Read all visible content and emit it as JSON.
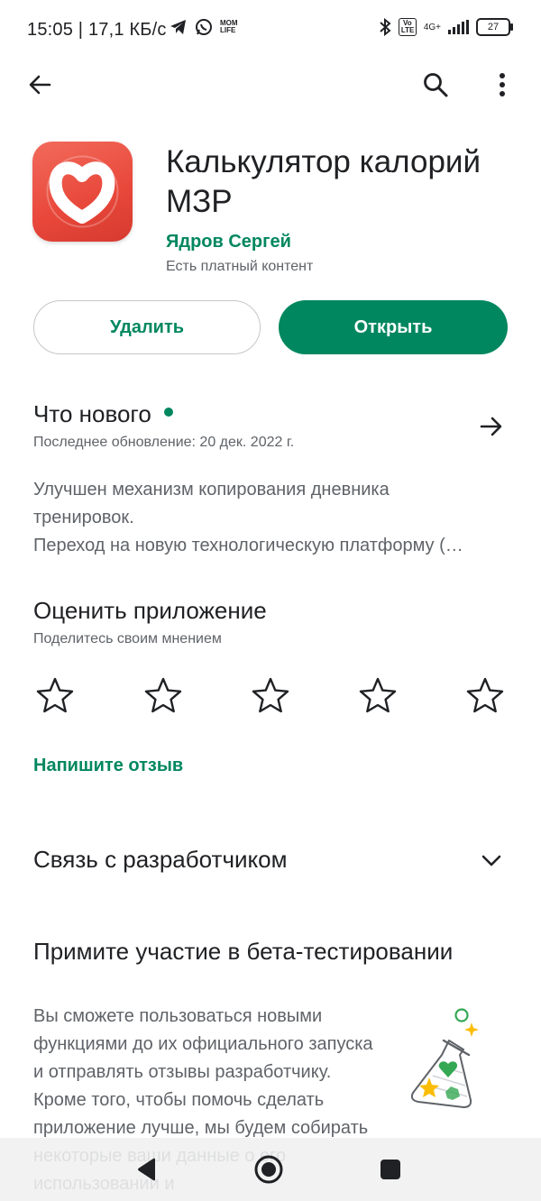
{
  "status_bar": {
    "time": "15:05 | 17,1 КБ/с",
    "battery": "27",
    "network": "4G+",
    "volte": "Vo LTE",
    "app_badge": "MOM LIFE"
  },
  "app": {
    "title": "Калькулятор калорий МЗР",
    "developer": "Ядров Сергей",
    "iap_notice": "Есть платный контент",
    "brand_color": "#01875f",
    "icon_color": "#e8473a"
  },
  "buttons": {
    "uninstall": "Удалить",
    "open": "Открыть"
  },
  "whats_new": {
    "title": "Что нового",
    "updated": "Последнее обновление: 20 дек. 2022 г.",
    "lines": [
      "Улучшен механизм копирования дневника",
      "тренировок.",
      "Переход на новую технологическую платформу (…"
    ]
  },
  "rate": {
    "title": "Оценить приложение",
    "subtitle": "Поделитесь своим мнением",
    "stars_total": 5,
    "write_review": "Напишите отзыв"
  },
  "contact": {
    "title": "Связь с разработчиком"
  },
  "beta": {
    "title": "Примите участие в бета-тестировании",
    "text": "Вы сможете пользоваться новыми функциями до их официального запуска и отправлять отзывы разработчику. Кроме того, чтобы помочь сделать приложение лучше, мы будем собирать некоторые ваши данные о его использовании и"
  },
  "icons": {
    "back": "arrow-left-icon",
    "search": "search-icon",
    "more": "more-vert-icon",
    "whats_new_arrow": "arrow-right-icon",
    "contact_chevron": "chevron-down-icon",
    "beta": "flask-icon"
  }
}
